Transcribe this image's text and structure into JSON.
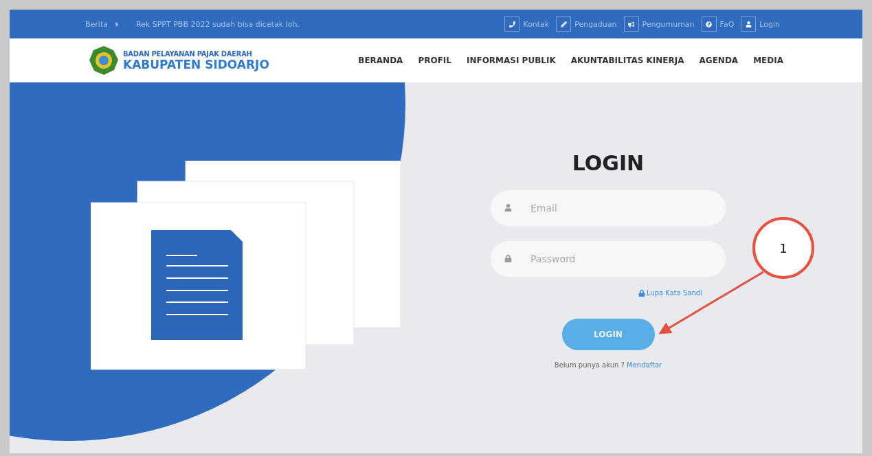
{
  "top_bar": {
    "news_label": "Berita",
    "news_text": "Rek SPPT PBB 2022 sudah bisa dicetak loh.",
    "links": [
      {
        "kind": "phone",
        "label": "Kontak"
      },
      {
        "kind": "pencil",
        "label": "Pengaduan"
      },
      {
        "kind": "megaphone",
        "label": "Pengumuman"
      },
      {
        "kind": "question",
        "label": "FaQ"
      },
      {
        "kind": "user",
        "label": "Login"
      }
    ]
  },
  "header": {
    "org_line": "BADAN PELAYANAN PAJAK DAERAH",
    "org_name": "KABUPATEN SIDOARJO",
    "nav": [
      "BERANDA",
      "PROFIL",
      "INFORMASI PUBLIK",
      "AKUNTABILITAS KINERJA",
      "AGENDA",
      "MEDIA"
    ]
  },
  "login": {
    "title": "LOGIN",
    "fields": [
      {
        "kind": "user",
        "placeholder": "Email"
      },
      {
        "kind": "lock",
        "placeholder": "Password"
      }
    ],
    "forgot_link": "Lupa Kata Sandi",
    "button": "LOGIN",
    "register_prompt": "Belum punya akun ?",
    "register_link": "Mendaftar"
  },
  "annotation": {
    "label": "1"
  }
}
